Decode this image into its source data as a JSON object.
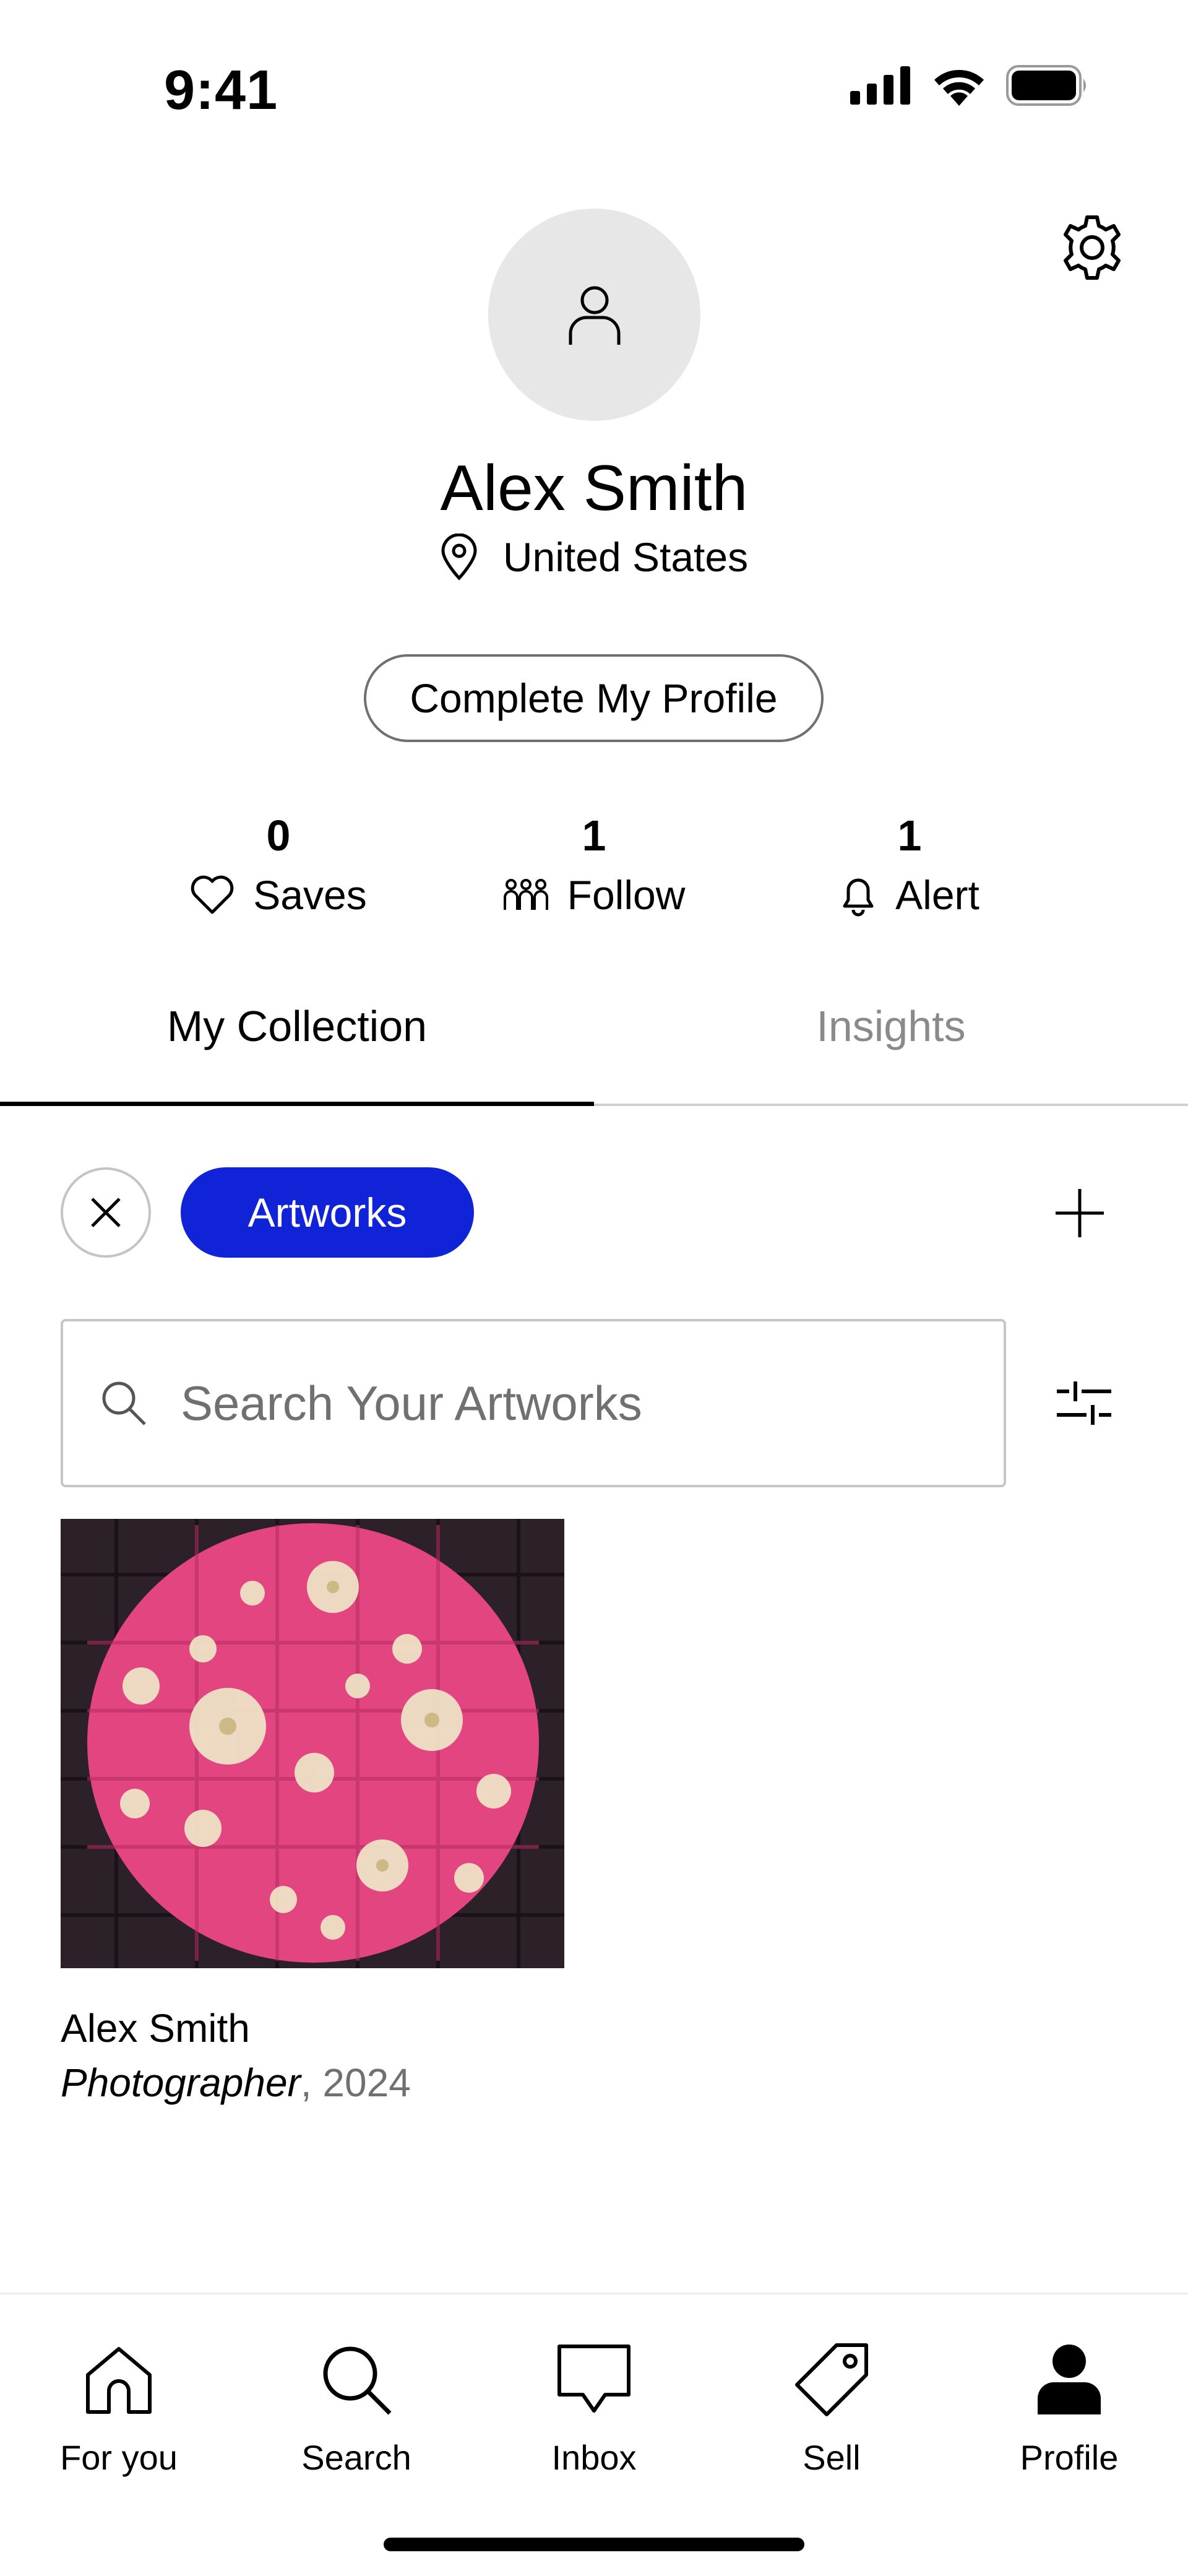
{
  "status_bar": {
    "time": "9:41"
  },
  "profile": {
    "name": "Alex Smith",
    "location": "United States",
    "complete_button": "Complete My Profile"
  },
  "stats": [
    {
      "count": "0",
      "label": "Saves",
      "icon": "heart-icon"
    },
    {
      "count": "1",
      "label": "Follow",
      "icon": "people-icon"
    },
    {
      "count": "1",
      "label": "Alert",
      "icon": "bell-icon"
    }
  ],
  "tabs": [
    {
      "label": "My Collection",
      "active": true
    },
    {
      "label": "Insights",
      "active": false
    }
  ],
  "filters": {
    "chip": "Artworks",
    "chip_color": "#1023d7"
  },
  "search": {
    "placeholder": "Search Your Artworks"
  },
  "artworks": [
    {
      "artist": "Alex Smith",
      "medium": "Photographer",
      "year": ", 2024"
    }
  ],
  "nav": [
    {
      "label": "For you",
      "icon": "home-icon"
    },
    {
      "label": "Search",
      "icon": "search-icon"
    },
    {
      "label": "Inbox",
      "icon": "inbox-icon"
    },
    {
      "label": "Sell",
      "icon": "tag-icon"
    },
    {
      "label": "Profile",
      "icon": "profile-icon",
      "active": true
    }
  ]
}
